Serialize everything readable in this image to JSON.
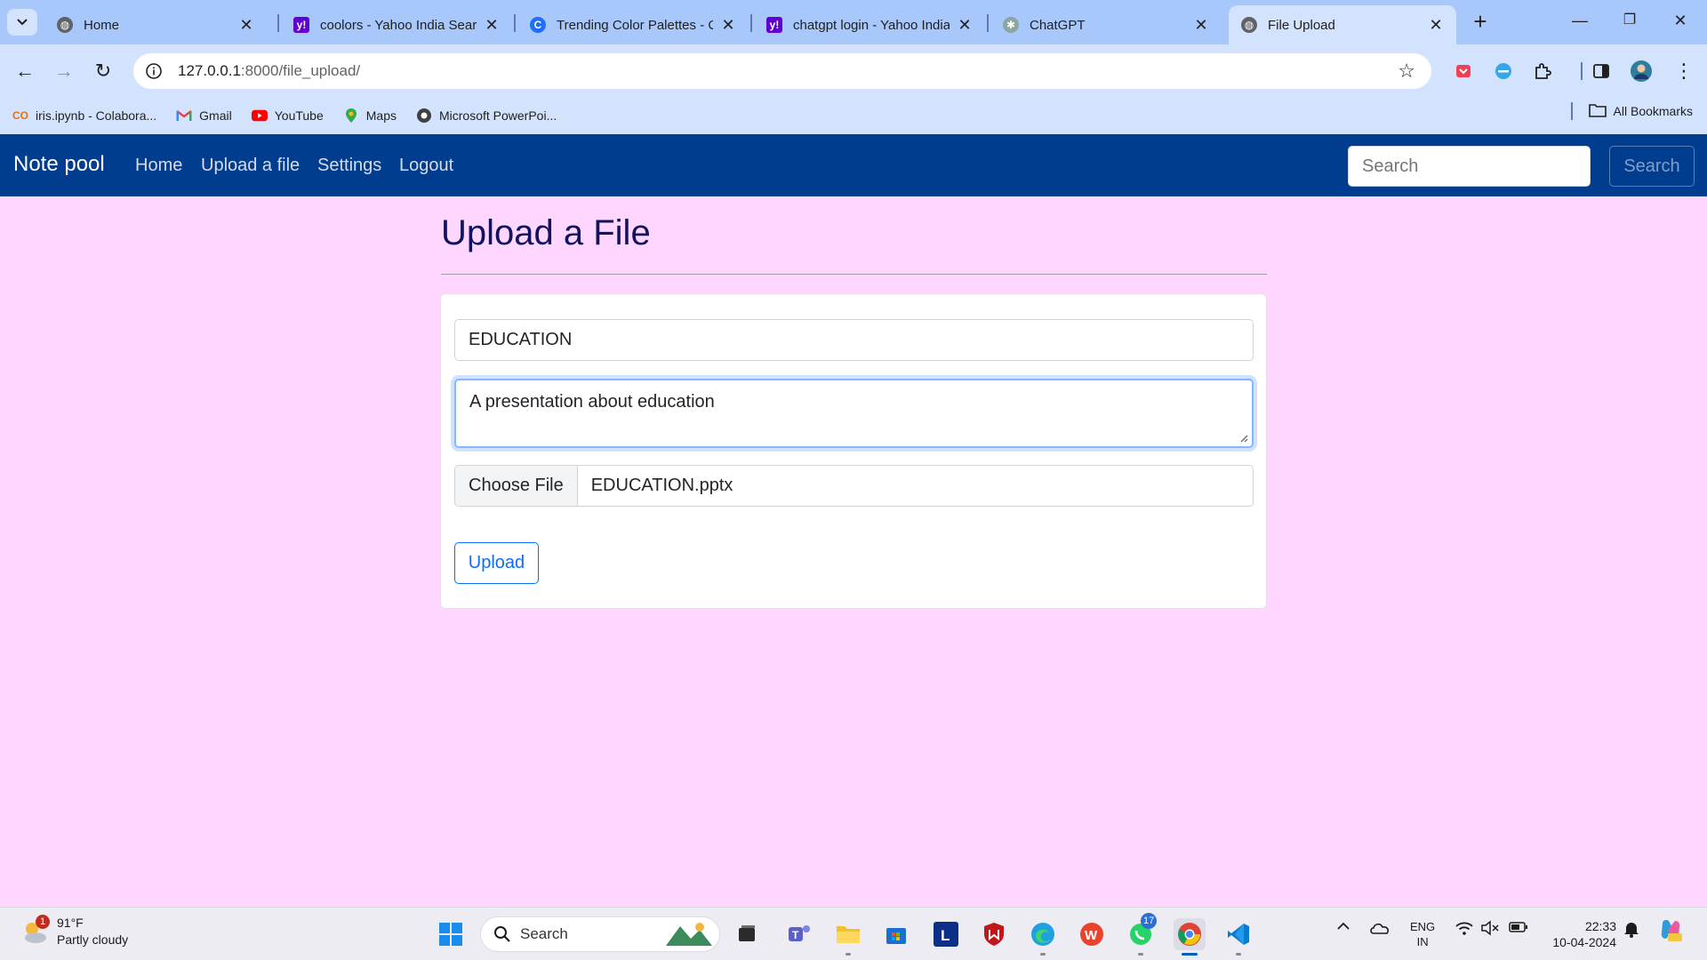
{
  "browser": {
    "tabs": [
      {
        "title": "Home",
        "active": false
      },
      {
        "title": "coolors - Yahoo India Search",
        "active": false
      },
      {
        "title": "Trending Color Palettes - Coolors",
        "active": false
      },
      {
        "title": "chatgpt login - Yahoo India",
        "active": false
      },
      {
        "title": "ChatGPT",
        "active": false
      },
      {
        "title": "File Upload",
        "active": true
      }
    ],
    "url_host": "127.0.0.1",
    "url_path": ":8000/file_upload/",
    "bookmarks": [
      {
        "label": "iris.ipynb - Colabora...",
        "icon": "colab-icon"
      },
      {
        "label": "Gmail",
        "icon": "gmail-icon"
      },
      {
        "label": "YouTube",
        "icon": "youtube-icon"
      },
      {
        "label": "Maps",
        "icon": "maps-icon"
      },
      {
        "label": "Microsoft PowerPoi...",
        "icon": "globe-icon"
      }
    ],
    "all_bookmarks_label": "All Bookmarks"
  },
  "navbar": {
    "brand": "Note pool",
    "links": [
      "Home",
      "Upload a file",
      "Settings",
      "Logout"
    ],
    "search_placeholder": "Search",
    "search_button": "Search"
  },
  "main": {
    "heading": "Upload a File",
    "form": {
      "title_value": "EDUCATION",
      "description_value": "A presentation  about education",
      "file_button_label": "Choose File",
      "file_name": "EDUCATION.pptx",
      "upload_label": "Upload"
    }
  },
  "taskbar": {
    "weather_temp": "91°F",
    "weather_desc": "Partly cloudy",
    "weather_badge": "1",
    "search_label": "Search",
    "whatsapp_badge": "17",
    "lang_top": "ENG",
    "lang_bottom": "IN",
    "time": "22:33",
    "date": "10-04-2024"
  },
  "colors": {
    "page_bg": "#ffd6ff",
    "navbar_bg": "#003d8f",
    "heading": "#12125e",
    "accent": "#0d6efd"
  }
}
